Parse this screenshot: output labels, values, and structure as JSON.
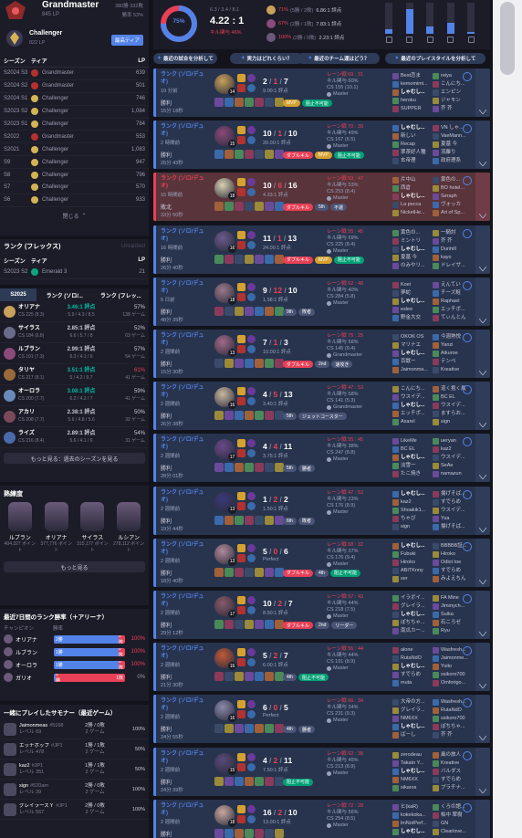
{
  "profile": {
    "rank1_name": "Grandmaster",
    "rank1_lp": "845 LP",
    "rank1_record": "380勝 332敗",
    "rank1_wr": "勝率 53%",
    "rank2_name": "Challenger",
    "rank2_lp": "822 LP",
    "rank2_badge": "最高ティア"
  },
  "season_table": {
    "headers": [
      "シーズン",
      "ティア",
      "LP"
    ],
    "rows": [
      {
        "season": "S2024 S3",
        "tier": "Grandmaster",
        "lp": "639",
        "color": "#b2322f"
      },
      {
        "season": "S2024 S2",
        "tier": "Grandmaster",
        "lp": "501",
        "color": "#b2322f"
      },
      {
        "season": "S2024 S1",
        "tier": "Challenger",
        "lp": "746",
        "color": "#d4b456"
      },
      {
        "season": "S2023 S2",
        "tier": "Challenger",
        "lp": "1,084",
        "color": "#d4b456"
      },
      {
        "season": "S2023 S1",
        "tier": "Challenger",
        "lp": "784",
        "color": "#d4b456"
      },
      {
        "season": "S2022",
        "tier": "Grandmaster",
        "lp": "553",
        "color": "#b2322f"
      },
      {
        "season": "S2021",
        "tier": "Challenger",
        "lp": "1,083",
        "color": "#d4b456"
      },
      {
        "season": "S9",
        "tier": "Challenger",
        "lp": "947",
        "color": "#d4b456"
      },
      {
        "season": "S8",
        "tier": "Challenger",
        "lp": "796",
        "color": "#d4b456"
      },
      {
        "season": "S7",
        "tier": "Challenger",
        "lp": "570",
        "color": "#d4b456"
      },
      {
        "season": "S6",
        "tier": "Challenger",
        "lp": "933",
        "color": "#d4b456"
      }
    ],
    "collapse": "閉じる"
  },
  "flex": {
    "title": "ランク (フレックス)",
    "unranked": "Unranked",
    "headers": [
      "シーズン",
      "ティア",
      "LP"
    ],
    "row": {
      "season": "S2023 S2",
      "tier": "Emerald 3",
      "lp": "21"
    }
  },
  "champ_tabs": {
    "season": "S2025",
    "tab1": "ランク (ソロ/...",
    "tab2": "ランク (フレッ..."
  },
  "champ_stats": [
    {
      "name": "オリアナ",
      "cs": "CS 225 (8.3)",
      "kda": "3.46:1 評点",
      "kda_detail": "5.9 / 4.3 / 8.5",
      "wr": "57%",
      "games": "138 ゲーム",
      "good": true
    },
    {
      "name": "サイラス",
      "cs": "CS 184 (6.8)",
      "kda": "2.85:1 評点",
      "kda_detail": "6.6 / 5.7 / 8",
      "wr": "52%",
      "games": "63 ゲーム",
      "good": false
    },
    {
      "name": "ルブラン",
      "cs": "CS 191 (7.3)",
      "kda": "2.99:1 評点",
      "kda_detail": "6.3 / 4.1 / 6",
      "wr": "57%",
      "games": "54 ゲーム",
      "good": false
    },
    {
      "name": "タリヤ",
      "cs": "CS 217 (8.1)",
      "kda": "3.51:1 評点",
      "kda_detail": "5 / 4.2 / 9.7",
      "wr": "61%",
      "games": "41 ゲーム",
      "good": true
    },
    {
      "name": "オーロラ",
      "cs": "CS 200 (7.7)",
      "kda": "3.08:1 評点",
      "kda_detail": "6.2 / 4.2 / 7",
      "wr": "59%",
      "games": "41 ゲーム",
      "good": true
    },
    {
      "name": "アカリ",
      "cs": "CS 208 (7.7)",
      "kda": "2.38:1 評点",
      "kda_detail": "5.6 / 4.8 / 5.6",
      "wr": "50%",
      "games": "32 ゲーム",
      "good": false
    },
    {
      "name": "ライズ",
      "cs": "CS 216 (8.4)",
      "kda": "2.89:1 評点",
      "kda_detail": "5.6 / 4.1 / 6",
      "wr": "54%",
      "games": "31 ゲーム",
      "good": false
    }
  ],
  "champ_more": "もっと見る：過去のシーズンを見る",
  "mastery": {
    "title": "熟練度",
    "items": [
      {
        "name": "ルブラン",
        "points": "404,327 ポイント"
      },
      {
        "name": "オリアナ",
        "points": "377,776 ポイント"
      },
      {
        "name": "サイラス",
        "points": "315,177 ポイント"
      },
      {
        "name": "ルシアン",
        "points": "278,112 ポイント"
      }
    ],
    "more": "もっと見る"
  },
  "recent7": {
    "title": "最近7日間のランク勝率（＋アリーナ）",
    "col1": "チャンピオン",
    "col2": "勝率",
    "rows": [
      {
        "name": "オリアナ",
        "w": "2勝",
        "l": "0敗",
        "wr": "100%",
        "wpct": 100
      },
      {
        "name": "ルブラン",
        "w": "1勝",
        "l": "0敗",
        "wr": "100%",
        "wpct": 100
      },
      {
        "name": "オーロラ",
        "w": "1勝",
        "l": "0敗",
        "wr": "100%",
        "wpct": 100
      },
      {
        "name": "ガリオ",
        "w": "0勝",
        "l": "1敗",
        "wr": "0%",
        "wpct": 0
      }
    ]
  },
  "played_with": {
    "title": "一緒にプレイしたサモナー（最近ゲーム）",
    "rows": [
      {
        "name": "Jaimonmeas",
        "tag": "#5168",
        "lvl": "レベル 69",
        "games": "2勝 / 0敗",
        "count": "2 ゲーム",
        "wr": "100%"
      },
      {
        "name": "エッチポップ",
        "tag": "#JP1",
        "lvl": "レベル 478",
        "games": "1勝 / 1敗",
        "count": "2 ゲーム",
        "wr": "50%"
      },
      {
        "name": "kaz2",
        "tag": "#JP1",
        "lvl": "レベル 351",
        "games": "1勝 / 1敗",
        "count": "2 ゲーム",
        "wr": "50%"
      },
      {
        "name": "sign",
        "tag": "#520am",
        "lvl": "レベル 39",
        "games": "2勝 / 0敗",
        "count": "2 ゲーム",
        "wr": "100%"
      },
      {
        "name": "グレイラーズＹ",
        "tag": "#JP1",
        "lvl": "レベル 567",
        "games": "2勝 / 0敗",
        "count": "2 ゲーム",
        "wr": "100%"
      }
    ]
  },
  "summary": {
    "winrate": "75%",
    "kda_line": "6.3 / 3.4 / 8.1",
    "kda_ratio": "4.22 : 1",
    "kill_part": "キル関与 46%",
    "top3": [
      {
        "wr": "71%",
        "rec": "(5勝 / 2敗)",
        "kda": "6.86:1 評点"
      },
      {
        "wr": "67%",
        "rec": "(2勝 / 1敗)",
        "kda": "7.83:1 評点"
      },
      {
        "wr": "100%",
        "rec": "(2勝 / 0敗)",
        "kda": "2.23:1 評点"
      }
    ],
    "role_levels": [
      0.15,
      0.8,
      0.25,
      0.35,
      0.05
    ]
  },
  "quick": [
    "最近の試合を分析して",
    "実力はどれくらい？",
    "最近のチーム運はどう？",
    "最近のプレイスタイルを分析して"
  ],
  "matches": [
    {
      "result": "win",
      "queue": "ランク (ソロ/デュオ)",
      "ago": "19 分前",
      "res": "勝利",
      "dur": "15分 18秒",
      "lvl": "14",
      "k": "2",
      "d": "1",
      "a": "7",
      "ratio": "9.00:1 評点",
      "tags": [
        [
          "MVP",
          "gold"
        ],
        [
          "阻止不可能",
          "green"
        ]
      ],
      "lane": "レーン戦 69 : 31",
      "kp": "キル関与 60%",
      "cs": "CS 155 (10.1)",
      "tier": "Master",
      "blue": [
        "Best恋ま",
        "kemomimi...",
        "しゃむし...",
        "heroku",
        "SUPPER"
      ],
      "red": [
        "reiya",
        "こんにち...",
        "エンピン",
        "ジャモン",
        "芥 芥"
      ]
    },
    {
      "result": "win",
      "queue": "ランク (ソロ/デュオ)",
      "ago": "2 時間前",
      "res": "勝利",
      "dur": "25分 43秒",
      "lvl": "15",
      "k": "10",
      "d": "1",
      "a": "10",
      "ratio": "20.00:1 評点",
      "tags": [
        [
          "ダブルキル",
          "red"
        ],
        [
          "MVP",
          "gold"
        ],
        [
          "阻止不可能",
          "green"
        ]
      ],
      "lane": "レーン戦 70 : 30",
      "kp": "キル関与 49%",
      "cs": "CS 167 (6.5)",
      "tier": "Master",
      "blue": [
        "しゃむし...",
        "新しい",
        "Recap",
        "翠茶好人種",
        "玄帝理"
      ],
      "red": [
        "VN しゃ...",
        "VaeMann...",
        "夏墓 今",
        "流離り",
        "政府理系"
      ]
    },
    {
      "result": "loss",
      "queue": "ランク (ソロ/デュオ)",
      "ago": "15 時間前",
      "res": "敗北",
      "dur": "33分 50秒",
      "lvl": "18",
      "k": "10",
      "d": "6",
      "a": "16",
      "ratio": "4.33:1 評点",
      "tags": [
        [
          "ダブルキル",
          "red"
        ],
        [
          "5th",
          "blue"
        ],
        [
          "不運",
          "blue"
        ]
      ],
      "lane": "レーン戦 53 : 47",
      "kp": "キル関与 53%",
      "cs": "CS 253 (8.4)",
      "tier": "Master",
      "blue": [
        "片中山",
        "西倉",
        "しゃむし...",
        "La pecca",
        "NickelHe..."
      ],
      "red": [
        "黄色の...",
        "BO hotel...",
        "Seraph",
        "ヴォッカ",
        "Art of Sp..."
      ]
    },
    {
      "result": "win",
      "queue": "ランク (ソロ/デュオ)",
      "ago": "16 時間前",
      "res": "勝利",
      "dur": "26分 40秒",
      "lvl": "16",
      "k": "11",
      "d": "1",
      "a": "13",
      "ratio": "24.00:1 評点",
      "tags": [
        [
          "ダブルキル",
          "red"
        ],
        [
          "MVP",
          "gold"
        ],
        [
          "阻止不可能",
          "green"
        ]
      ],
      "lane": "レーン戦 55 : 45",
      "kp": "キル関与 69%",
      "cs": "CS 225 (8.4)",
      "tier": "Master",
      "blue": [
        "黄色の...",
        "ミントリ",
        "しゃむし...",
        "夏墓 今",
        "のみやリ..."
      ],
      "red": [
        "一騎討",
        "芥 芥",
        "Dunhill",
        "kayo",
        "ドレイザ..."
      ]
    },
    {
      "result": "win",
      "queue": "ランク (ソロ/デュオ)",
      "ago": "5 日前",
      "res": "勝利",
      "dur": "48分 35秒",
      "lvl": "18",
      "k": "9",
      "d": "12",
      "a": "10",
      "ratio": "1.58:1 評点",
      "tags": [
        [
          "9th",
          "blue"
        ],
        [
          "敗者",
          "blue"
        ]
      ],
      "lane": "レーン戦 52 : 48",
      "kp": "キル関与 40%",
      "cs": "CS 284 (5.8)",
      "tier": "Master",
      "blue": [
        "Koei",
        "夢蛇",
        "しゃむし...",
        "eslee",
        "野金大交"
      ],
      "red": [
        "えんてい",
        "チーズ鮭",
        "Raphael",
        "エッチボ...",
        "てぃんとん"
      ]
    },
    {
      "result": "win",
      "queue": "ランク (ソロ/デュオ)",
      "ago": "2 週間前",
      "res": "勝利",
      "dur": "15分 30秒",
      "lvl": "13",
      "k": "7",
      "d": "1",
      "a": "3",
      "ratio": "10.00:1 評点",
      "tags": [
        [
          "ダブルキル",
          "red"
        ],
        [
          "2nd",
          "blue"
        ],
        [
          "速攻き",
          "blue"
        ]
      ],
      "lane": "レーン戦 75 : 25",
      "kp": "キル関与 56%",
      "cs": "CS 145 (9.4)",
      "tier": "Grandmaster",
      "blue": [
        "OKOK OS",
        "マリナエ",
        "しゃむし...",
        "百獣ー",
        "Jaimonma..."
      ],
      "red": [
        "今週熟悦",
        "Yanzi",
        "Aikuroe",
        "テンペ",
        "Kreative"
      ]
    },
    {
      "result": "win",
      "queue": "ランク (ソロ/デュオ)",
      "ago": "2 週間前",
      "res": "勝利",
      "dur": "26分 38秒",
      "lvl": "16",
      "k": "4",
      "d": "5",
      "a": "13",
      "ratio": "3.40:1 評点",
      "tags": [
        [
          "5th",
          "blue"
        ],
        [
          "ジェットコースター",
          "blue"
        ]
      ],
      "lane": "レーン戦 47 : 53",
      "kp": "キル関与 58%",
      "cs": "CS 141 (5.3)",
      "tier": "Grandmaster",
      "blue": [
        "こんにち...",
        "ウスイデ...",
        "しゃむし...",
        "エッチボ...",
        "Asarel"
      ],
      "red": [
        "道く抱く風",
        "BC EL",
        "ウスイデ...",
        "ますらお...",
        "sign"
      ]
    },
    {
      "result": "win",
      "queue": "ランク (ソロ/デュオ)",
      "ago": "2 週間前",
      "res": "勝利",
      "dur": "28分 01秒",
      "lvl": "17",
      "k": "4",
      "d": "4",
      "a": "11",
      "ratio": "3.75:1 評点",
      "tags": [
        [
          "5th",
          "blue"
        ],
        [
          "勝者",
          "blue"
        ]
      ],
      "lane": "レーン戦 55 : 45",
      "kp": "キル関与 38%",
      "cs": "CS 247 (8.8)",
      "tier": "Master",
      "blue": [
        "LikeMe",
        "BC EL",
        "しゃむし...",
        "淡雪一",
        "たこ焼き"
      ],
      "red": [
        "ueryan",
        "kaz2",
        "ウスイデ...",
        "SeAe",
        "namazun"
      ]
    },
    {
      "result": "win",
      "queue": "ランク (ソロ/デュオ)",
      "ago": "2 週間前",
      "res": "勝利",
      "dur": "19分 44秒",
      "lvl": "13",
      "k": "1",
      "d": "2",
      "a": "2",
      "ratio": "1.50:1 評点",
      "tags": [
        [
          "6th",
          "blue"
        ],
        [
          "敗者",
          "blue"
        ]
      ],
      "lane": "レーン戦 47 : 53",
      "kp": "キル関与 23%",
      "cs": "CS 176 (8.9)",
      "tier": "Master",
      "blue": [
        "しゃむし...",
        "kaz2",
        "Shoakik1...",
        "ちゃび",
        "sign"
      ],
      "red": [
        "揚げそば...",
        "すでらめ",
        "ウスイデ...",
        "Yua",
        "揚げそば..."
      ]
    },
    {
      "result": "win",
      "queue": "ランク (ソロ/デュオ)",
      "ago": "2 週間前",
      "res": "勝利",
      "dur": "18分 40秒",
      "lvl": "13",
      "k": "5",
      "d": "0",
      "a": "6",
      "ratio": "Perfect",
      "tags": [
        [
          "ダブルキル",
          "red"
        ],
        [
          "4th",
          "blue"
        ],
        [
          "阻止不可能",
          "green"
        ]
      ],
      "lane": "レーン戦 68 : 32",
      "kp": "キル関与 37%",
      "cs": "CS 176 (9.4)",
      "tier": "Master",
      "blue": [
        "しゃむし...",
        "Fubuki",
        "Hiroko",
        "ABITKnny",
        "ser"
      ],
      "red": [
        "BBBBB証...",
        "Hiroko",
        "Odlot toe",
        "すでらめ",
        "みよえちん"
      ]
    },
    {
      "result": "win",
      "queue": "ランク (ソロ/デュオ)",
      "ago": "2 週間前",
      "res": "勝利",
      "dur": "29分 12秒",
      "lvl": "17",
      "k": "10",
      "d": "2",
      "a": "7",
      "ratio": "8.50:1 評点",
      "tags": [
        [
          "ダブルキル",
          "red"
        ],
        [
          "2nd",
          "blue"
        ],
        [
          "リーダー",
          "blue"
        ]
      ],
      "lane": "レーン戦 57 : 43",
      "kp": "キル関与 44%",
      "cs": "CS 218 (7.5)",
      "tier": "Master",
      "blue": [
        "イラボイ...",
        "グレイラ...",
        "しゃむし...",
        "ぽちちゃ...",
        "南瓜カー..."
      ],
      "red": [
        "FA Mine",
        "Jimmych...",
        "Suika",
        "石ころゼ",
        "Ryu"
      ]
    },
    {
      "result": "win",
      "queue": "ランク (ソロ/デュオ)",
      "ago": "2 週間前",
      "res": "勝利",
      "dur": "21分 30秒",
      "lvl": "16",
      "k": "5",
      "d": "2",
      "a": "7",
      "ratio": "6.00:1 評点",
      "tags": [
        [
          "4th",
          "blue"
        ],
        [
          "阻止不可能",
          "green"
        ]
      ],
      "lane": "レーン戦 56 : 44",
      "kp": "キル関与 44%",
      "cs": "CS 191 (8.9)",
      "tier": "Master",
      "blue": [
        "alone",
        "RutaNdO",
        "しゃむし...",
        "すでらめ",
        "muta"
      ],
      "red": [
        "Wasfresh...",
        "Jaimonme...",
        "Yuito",
        "ssikoro700",
        "Omforigo..."
      ]
    },
    {
      "result": "win",
      "queue": "ランク (ソロ/デュオ)",
      "ago": "2 週間前",
      "res": "勝利",
      "dur": "24分 55秒",
      "lvl": "16",
      "k": "6",
      "d": "0",
      "a": "5",
      "ratio": "Perfect",
      "tags": [
        [
          "4th",
          "blue"
        ],
        [
          "勝者",
          "blue"
        ]
      ],
      "lane": "レーン戦 66 : 34",
      "kp": "キル関与 34%",
      "cs": "CS 231 (9.3)",
      "tier": "Master",
      "blue": [
        "大帝の方...",
        "グレイラ...",
        "NM6XX",
        "しゃむし...",
        "ばーし"
      ],
      "red": [
        "Wasfresh...",
        "RutaNdO",
        "ssikoro700",
        "ぽちちゃ...",
        "芥 芥"
      ]
    },
    {
      "result": "win",
      "queue": "ランク (ソロ/デュオ)",
      "ago": "2 週間前",
      "res": "勝利",
      "dur": "24分 39秒",
      "lvl": "15",
      "k": "4",
      "d": "2",
      "a": "11",
      "ratio": "7.50:1 評点",
      "tags": [
        [
          "阻止不可能",
          "green"
        ]
      ],
      "lane": "レーン戦 62 : 38",
      "kp": "キル関与 45%",
      "cs": "CS 213 (8.9)",
      "tier": "Master",
      "blue": [
        "zerodeau",
        "Takato Y...",
        "しゃむし...",
        "NM6XX",
        "sikaros"
      ],
      "red": [
        "風の旅人",
        "Kreative",
        "バルダス",
        "すでらめ",
        "プラチナ..."
      ]
    },
    {
      "result": "win",
      "queue": "ランク (ソロ/デュオ)",
      "ago": "2 週間前",
      "res": "勝利",
      "dur": "23分 19秒",
      "lvl": "18",
      "k": "16",
      "d": "2",
      "a": "10",
      "ratio": "13.00:1 評点",
      "tags": [],
      "lane": "レーン戦 72 : 28",
      "kp": "キル関与 56%",
      "cs": "CS 254 (8.5)",
      "tier": "Master",
      "blue": [
        "ヒ(kaR)",
        "kokekoka...",
        "lmNotPerf...",
        "しゃむし...",
        ""
      ],
      "red": [
        "くろの語...",
        "柏中 翠樹",
        "GN",
        "Clearlove...",
        ""
      ]
    }
  ]
}
